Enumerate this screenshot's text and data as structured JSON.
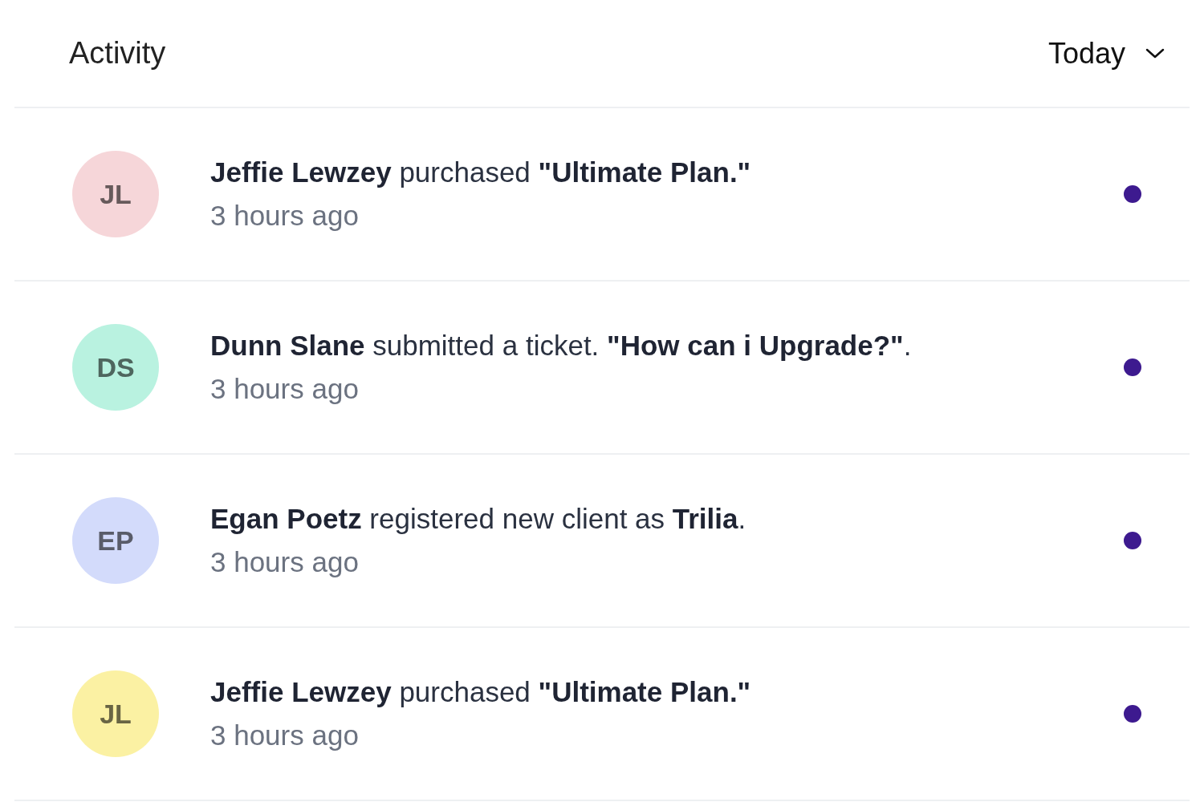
{
  "header": {
    "title": "Activity",
    "filter": "Today"
  },
  "activities": [
    {
      "initials": "JL",
      "color": "#f6d6d9",
      "message": "**Jeffie Lewzey** purchased **\"Ultimate Plan.\"**",
      "time": "3 hours ago",
      "unread": true
    },
    {
      "initials": "DS",
      "color": "#b9f2e0",
      "message": "**Dunn Slane** submitted a ticket. **\"How can i Upgrade?\"**.",
      "time": "3 hours ago",
      "unread": true
    },
    {
      "initials": "EP",
      "color": "#d3dbfb",
      "message": "**Egan Poetz** registered new client as **Trilia**.",
      "time": "3 hours ago",
      "unread": true
    },
    {
      "initials": "JL",
      "color": "#fbf1a3",
      "message": "**Jeffie Lewzey** purchased **\"Ultimate Plan.\"**",
      "time": "3 hours ago",
      "unread": true
    }
  ]
}
